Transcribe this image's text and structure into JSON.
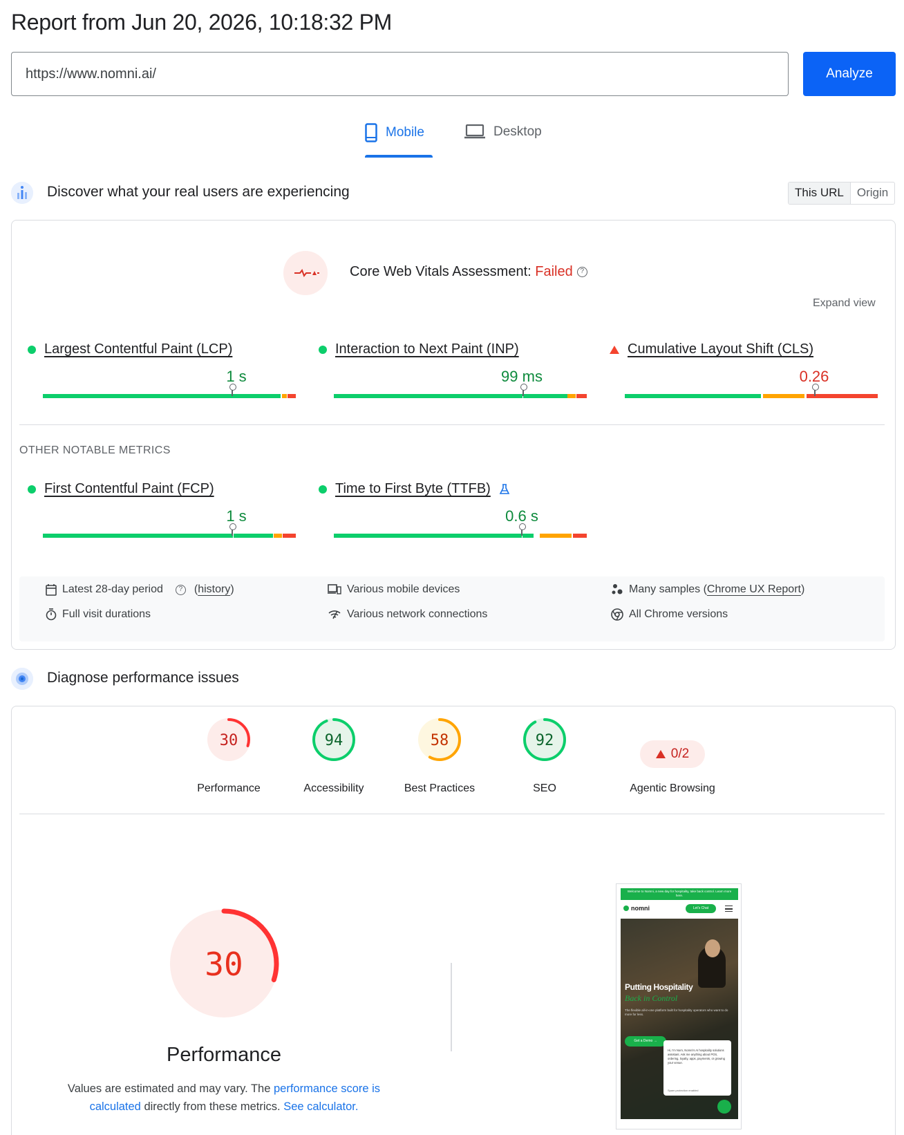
{
  "report": {
    "title": "Report from Jun 20, 2026, 10:18:32 PM"
  },
  "search": {
    "url_value": "https://www.nomni.ai/",
    "analyze_label": "Analyze"
  },
  "tabs": {
    "mobile": "Mobile",
    "desktop": "Desktop"
  },
  "field": {
    "title": "Discover what your real users are experiencing",
    "toggle": {
      "this_url": "This URL",
      "origin": "Origin"
    },
    "assessment_prefix": "Core Web Vitals Assessment: ",
    "assessment_status": "Failed",
    "expand": "Expand view",
    "core_metrics": [
      {
        "name": "Largest Contentful Paint (LCP)",
        "value": "1 s",
        "status": "good"
      },
      {
        "name": "Interaction to Next Paint (INP)",
        "value": "99 ms",
        "status": "good"
      },
      {
        "name": "Cumulative Layout Shift (CLS)",
        "value": "0.26",
        "status": "poor"
      }
    ],
    "other_label": "OTHER NOTABLE METRICS",
    "other_metrics": [
      {
        "name": "First Contentful Paint (FCP)",
        "value": "1 s",
        "status": "good"
      },
      {
        "name": "Time to First Byte (TTFB)",
        "value": "0.6 s",
        "status": "good"
      }
    ],
    "info": {
      "period": "Latest 28-day period",
      "history_open": "(",
      "history": "history",
      "history_close": ")",
      "durations": "Full visit durations",
      "devices": "Various mobile devices",
      "network": "Various network connections",
      "samples_prefix": "Many samples (",
      "samples_link": "Chrome UX Report",
      "samples_suffix": ")",
      "chrome": "All Chrome versions"
    }
  },
  "lab": {
    "title": "Diagnose performance issues",
    "scores": [
      {
        "label": "Performance",
        "score": "30",
        "value": 30,
        "color": "#f33",
        "bg": "#fdecea",
        "text": "#c5221f"
      },
      {
        "label": "Accessibility",
        "score": "94",
        "value": 94,
        "color": "#0cce6b",
        "bg": "#e6f4ea",
        "text": "#0d652d"
      },
      {
        "label": "Best Practices",
        "score": "58",
        "value": 58,
        "color": "#ffa400",
        "bg": "#fef7e0",
        "text": "#c33300"
      },
      {
        "label": "SEO",
        "score": "92",
        "value": 92,
        "color": "#0cce6b",
        "bg": "#e6f4ea",
        "text": "#0d652d"
      }
    ],
    "agentic": {
      "label": "Agentic Browsing",
      "score": "0/2"
    },
    "perf_big": {
      "score": "30",
      "value": 30,
      "label": "Performance"
    },
    "desc": {
      "part1": "Values are estimated and may vary. The ",
      "link1": "performance score is calculated",
      "part2": " directly from these metrics. ",
      "link2": "See calculator."
    }
  },
  "screenshot": {
    "banner": "Welcome to Nomni, a new day for hospitality, take back control. Learn more here.",
    "brand": "nomni",
    "chat_btn": "Let's Chat",
    "hero_title": "Putting Hospitality",
    "hero_sub": "Back in Control",
    "hero_text": "The flexible all-in-one platform built for hospitality operators who want to do more for less.",
    "demo_btn": "Get a Demo →",
    "chat_text": "Hi, I'm Norn, Nomni's AI hospitality solutions assistant. Ask me anything about POS, ordering, loyalty, apps, payments, or growing your venue.",
    "chat_footer": "Spam protection enabled"
  }
}
